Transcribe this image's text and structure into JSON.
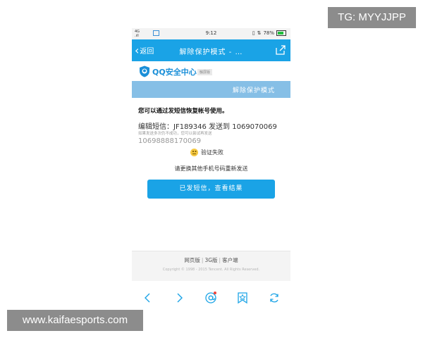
{
  "watermark": {
    "top_right": "TG: MYYJJPP",
    "bottom_left": "www.kaifaesports.com"
  },
  "statusbar": {
    "signal": "4G\n.ıll",
    "time": "9:12",
    "battery": "78%"
  },
  "titlebar": {
    "back_label": "返回",
    "title": "解除保护模式 - …"
  },
  "brand": {
    "name": "QQ安全中心",
    "badge": "触屏版"
  },
  "section_bar": {
    "label": "解除保护模式"
  },
  "content": {
    "heading": "您可以通过发短信恢复帐号使用。",
    "sms_instruction": "编辑短信：JF189346 发送到 1069070069",
    "hint": "如果发送多次仍不成功，您可以尝试再发送",
    "alt_number": "10698888170069",
    "fail_text": "验证失败",
    "retry_tip": "请更换其他手机号码重新发送",
    "button_label": "已发短信，查看结果"
  },
  "footer": {
    "links": [
      "网页版",
      "3G版",
      "客户端"
    ],
    "copyright": "Copyright © 1998 - 2015 Tencent. All Rights Reserved."
  },
  "bottom_nav": {
    "icons": [
      "chevron-left-icon",
      "chevron-right-icon",
      "at-icon",
      "bookmark-star-icon",
      "refresh-icon"
    ],
    "accent": "#1aa3e6"
  },
  "colors": {
    "primary": "#1aa3e6",
    "section_bar": "#86bfe6",
    "brand_text": "#1a8fd8"
  }
}
